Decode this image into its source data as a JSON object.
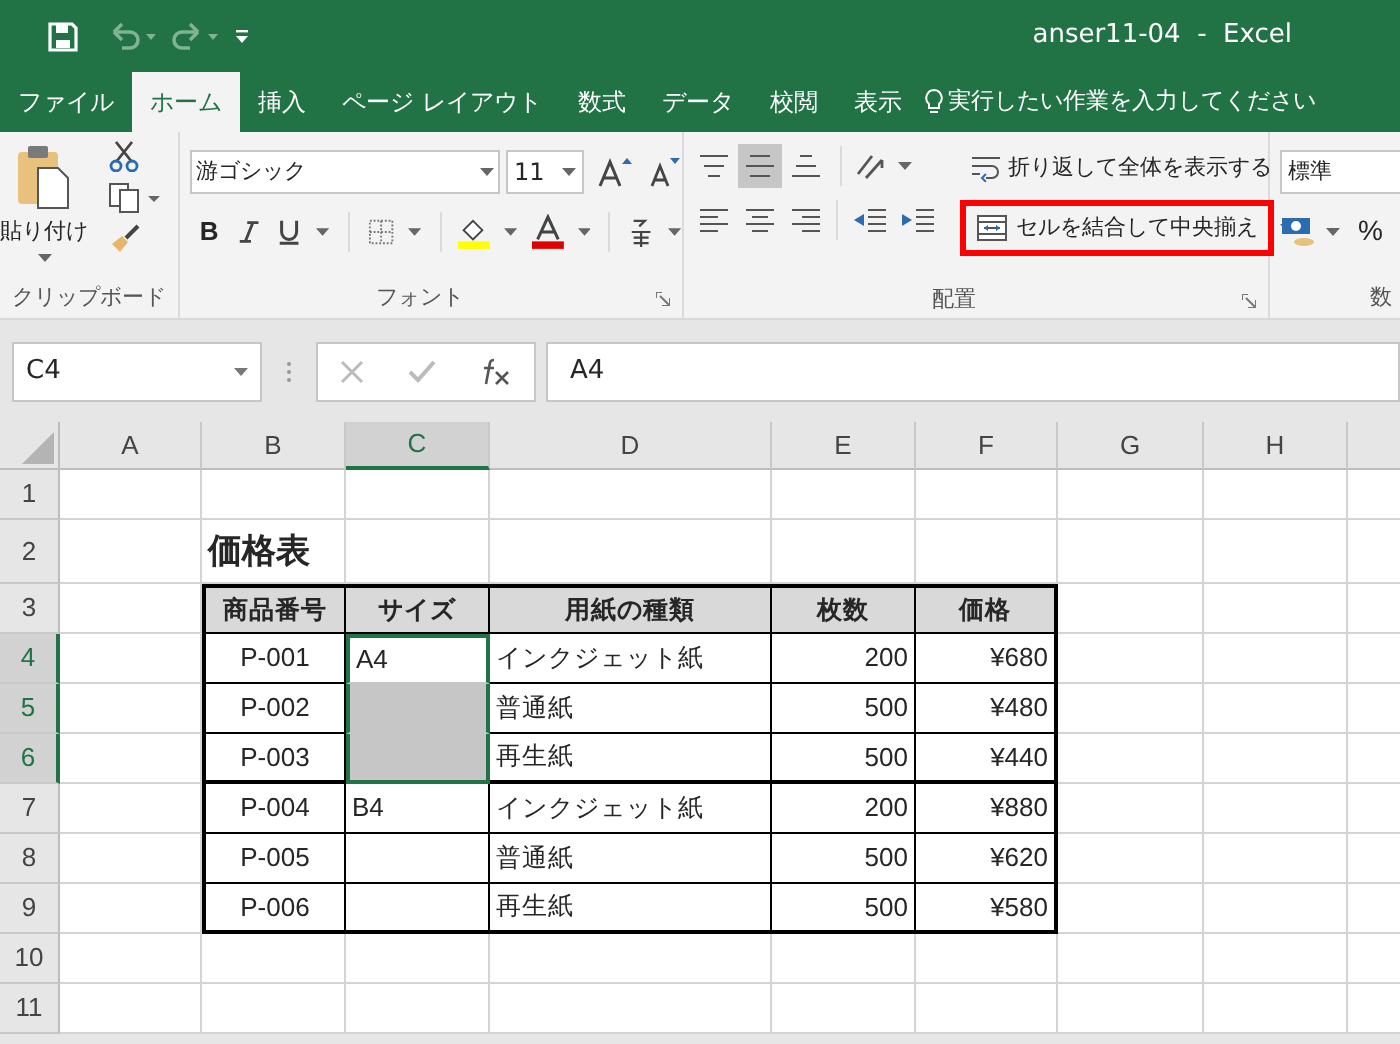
{
  "title_bar": {
    "title": "anser11-04  -  Excel"
  },
  "tabs": [
    {
      "label": "ファイル",
      "selected": false
    },
    {
      "label": "ホーム",
      "selected": true
    },
    {
      "label": "挿入",
      "selected": false
    },
    {
      "label": "ページ レイアウト",
      "selected": false
    },
    {
      "label": "数式",
      "selected": false
    },
    {
      "label": "データ",
      "selected": false
    },
    {
      "label": "校閲",
      "selected": false
    },
    {
      "label": "表示",
      "selected": false
    }
  ],
  "tell_me": {
    "placeholder": "実行したい作業を入力してください"
  },
  "ribbon": {
    "clipboard": {
      "paste_label": "貼り付け",
      "group_label": "クリップボード"
    },
    "font": {
      "font_name": "游ゴシック",
      "font_size": "11",
      "bold_button": "B",
      "group_label": "フォント"
    },
    "alignment": {
      "vertical_align": [
        {
          "selected": false
        },
        {
          "selected": true
        },
        {
          "selected": false
        }
      ],
      "wrap_text": "折り返して全体を表示する",
      "merge_center": {
        "label": "セルを結合して中央揃え",
        "highlighted": true
      },
      "group_label": "配置"
    },
    "number": {
      "format": "標準",
      "percent_button": "%",
      "group_label": "数"
    }
  },
  "formula_bar": {
    "name_box": "C4",
    "formula": "A4"
  },
  "sheet": {
    "columns": [
      {
        "label": "A",
        "selected": false
      },
      {
        "label": "B",
        "selected": false
      },
      {
        "label": "C",
        "selected": true
      },
      {
        "label": "D",
        "selected": false
      },
      {
        "label": "E",
        "selected": false
      },
      {
        "label": "F",
        "selected": false
      },
      {
        "label": "G",
        "selected": false
      },
      {
        "label": "H",
        "selected": false
      }
    ],
    "rows": [
      {
        "label": "1",
        "selected": false
      },
      {
        "label": "2",
        "selected": false
      },
      {
        "label": "3",
        "selected": false
      },
      {
        "label": "4",
        "selected": true
      },
      {
        "label": "5",
        "selected": true
      },
      {
        "label": "6",
        "selected": true
      },
      {
        "label": "7",
        "selected": false
      },
      {
        "label": "8",
        "selected": false
      },
      {
        "label": "9",
        "selected": false
      },
      {
        "label": "10",
        "selected": false
      },
      {
        "label": "11",
        "selected": false
      }
    ]
  },
  "price_table": {
    "title": "価格表",
    "headers": [
      "商品番号",
      "サイズ",
      "用紙の種類",
      "枚数",
      "価格"
    ],
    "rows": [
      {
        "product_no": "P-001",
        "size": "A4",
        "size_in_selection": true,
        "size_shaded": false,
        "paper_type": "インクジェット紙",
        "quantity": "200",
        "price": "¥680",
        "thick_bottom": false
      },
      {
        "product_no": "P-002",
        "size_in_selection": true,
        "size_shaded": true,
        "paper_type": "普通紙",
        "quantity": "500",
        "price": "¥480",
        "thick_bottom": false
      },
      {
        "product_no": "P-003",
        "size_in_selection": true,
        "size_shaded": true,
        "paper_type": "再生紙",
        "quantity": "500",
        "price": "¥440",
        "thick_bottom": true
      },
      {
        "product_no": "P-004",
        "size": "B4",
        "size_in_selection": false,
        "size_shaded": false,
        "paper_type": "インクジェット紙",
        "quantity": "200",
        "price": "¥880",
        "thick_bottom": false
      },
      {
        "product_no": "P-005",
        "size_in_selection": false,
        "size_shaded": false,
        "paper_type": "普通紙",
        "quantity": "500",
        "price": "¥620",
        "thick_bottom": false
      },
      {
        "product_no": "P-006",
        "size_in_selection": false,
        "size_shaded": false,
        "paper_type": "再生紙",
        "quantity": "500",
        "price": "¥580",
        "thick_bottom": true
      }
    ]
  }
}
